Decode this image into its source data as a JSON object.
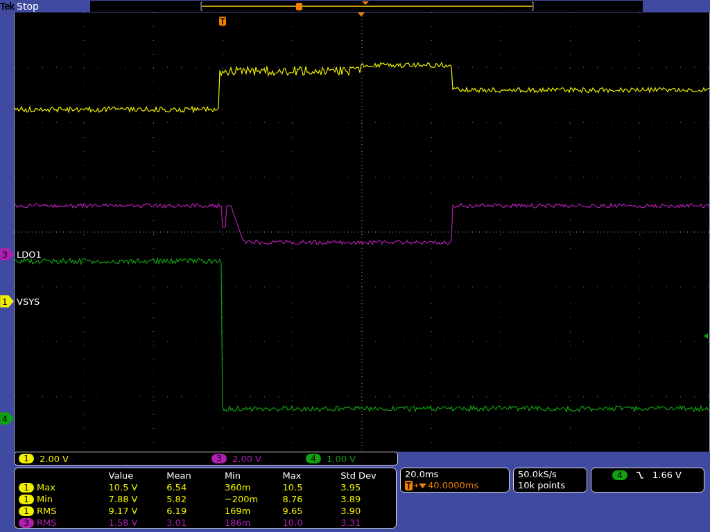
{
  "status": {
    "brand": "Tek",
    "state": "Stop"
  },
  "channel_markers": [
    {
      "number": "3",
      "label": "LDO1",
      "color": "#b020b0"
    },
    {
      "number": "1",
      "label": "VSYS",
      "color": "#f0f000"
    },
    {
      "number": "4",
      "color": "#10a010"
    }
  ],
  "scales": [
    {
      "channel": "1",
      "value": "2.00 V",
      "color": "#f0f000"
    },
    {
      "channel": "3",
      "value": "2.00 V",
      "color": "#b020b0"
    },
    {
      "channel": "4",
      "value": "1.00 V",
      "color": "#10a010"
    }
  ],
  "measurements": {
    "columns": [
      "Value",
      "Mean",
      "Min",
      "Max",
      "Std Dev"
    ],
    "rows": [
      {
        "channel": "1",
        "type": "Max",
        "color": "#f0f000",
        "cells": [
          "10.5 V",
          "6.54",
          "360m",
          "10.5",
          "3.95"
        ]
      },
      {
        "channel": "1",
        "type": "Min",
        "color": "#f0f000",
        "cells": [
          "7.88 V",
          "5.82",
          "−200m",
          "8.76",
          "3.89"
        ]
      },
      {
        "channel": "1",
        "type": "RMS",
        "color": "#f0f000",
        "cells": [
          "9.17 V",
          "6.19",
          "169m",
          "9.65",
          "3.90"
        ]
      },
      {
        "channel": "3",
        "type": "RMS",
        "color": "#b020b0",
        "cells": [
          "1.58 V",
          "3.01",
          "186m",
          "10.0",
          "3.31"
        ]
      }
    ]
  },
  "timebase": {
    "scale": "20.0ms",
    "trigger_position": "40.0000ms"
  },
  "acquisition": {
    "sample_rate": "50.0kS/s",
    "record_length": "10k points"
  },
  "trigger": {
    "channel": "4",
    "level": "1.66 V",
    "color": "#10a010"
  }
}
